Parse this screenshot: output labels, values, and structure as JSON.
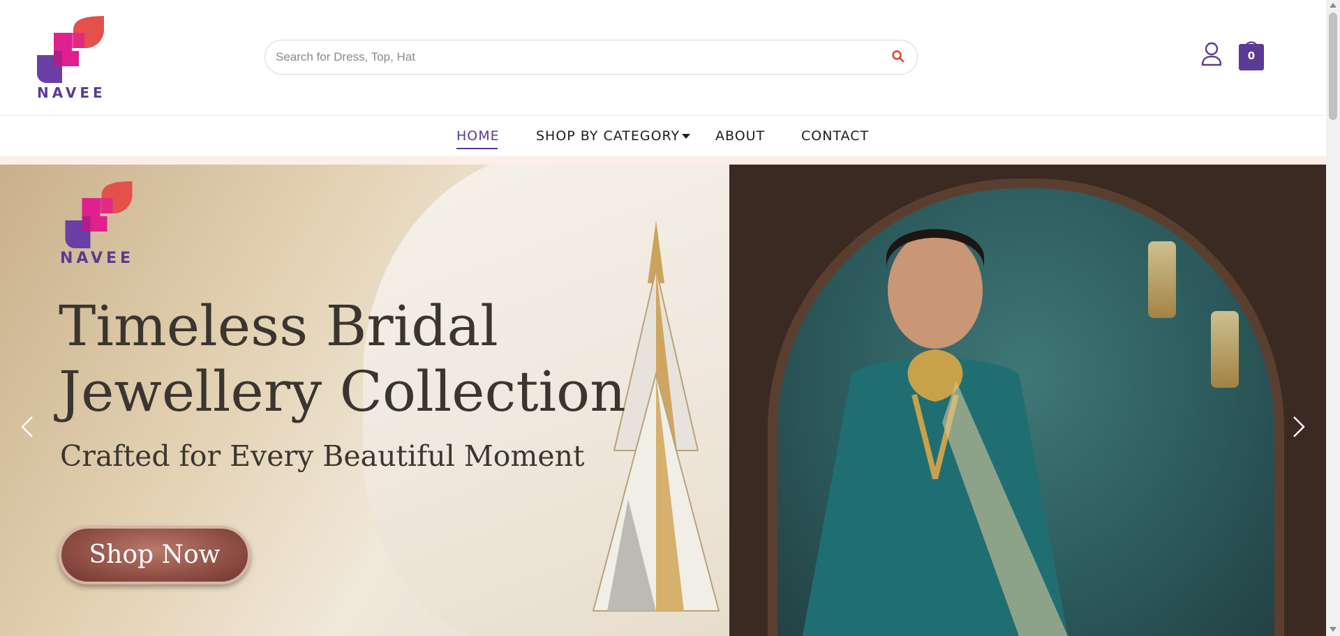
{
  "brand": {
    "name": "NAVEE",
    "colors": {
      "primary": "#5b3a93",
      "accent_pink": "#e0208f",
      "accent_red": "#e5504a"
    }
  },
  "header": {
    "search": {
      "placeholder": "Search for Dress, Top, Hat",
      "value": "",
      "icon": "search-icon"
    },
    "user_icon": "user-icon",
    "cart": {
      "icon": "shopping-bag-icon",
      "count": "0"
    }
  },
  "nav": {
    "items": [
      {
        "label": "HOME",
        "active": true
      },
      {
        "label": "SHOP BY CATEGORY",
        "has_dropdown": true
      },
      {
        "label": "ABOUT"
      },
      {
        "label": "CONTACT"
      }
    ]
  },
  "hero": {
    "brand_word": "NAVEE",
    "title_line1": "Timeless Bridal",
    "title_line2": "Jewellery Collection",
    "subtitle": "Crafted for Every Beautiful Moment",
    "cta_label": "Shop Now",
    "prev_icon": "chevron-left-icon",
    "next_icon": "chevron-right-icon"
  }
}
